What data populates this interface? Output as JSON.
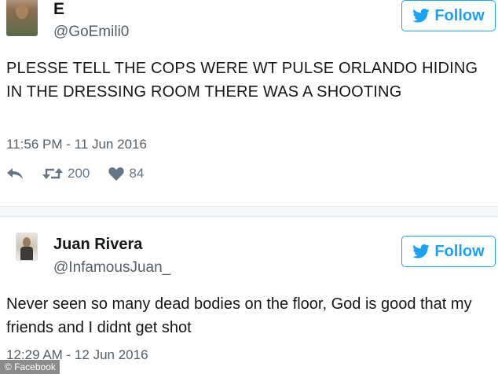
{
  "tweets": [
    {
      "name": "E",
      "handle": "@GoEmili0",
      "follow_label": "Follow",
      "text": "PLESSE TELL THE COPS WERE WT PULSE ORLANDO HIDING IN THE DRESSING ROOM THERE WAS A SHOOTING",
      "timestamp": "11:56 PM - 11 Jun 2016",
      "retweets": "200",
      "likes": "84"
    },
    {
      "name": "Juan Rivera",
      "handle": "@InfamousJuan_",
      "follow_label": "Follow",
      "text": "Never seen so many dead bodies on the floor, God is good that my friends and I didnt get shot",
      "timestamp": "12:29 AM - 12 Jun 2016"
    }
  ],
  "watermark": "© Facebook",
  "colors": {
    "accent": "#1da1f2",
    "muted": "#657786",
    "divider": "#e1e8ed"
  },
  "icons": [
    "twitter-bird-icon",
    "reply-icon",
    "retweet-icon",
    "heart-icon"
  ]
}
